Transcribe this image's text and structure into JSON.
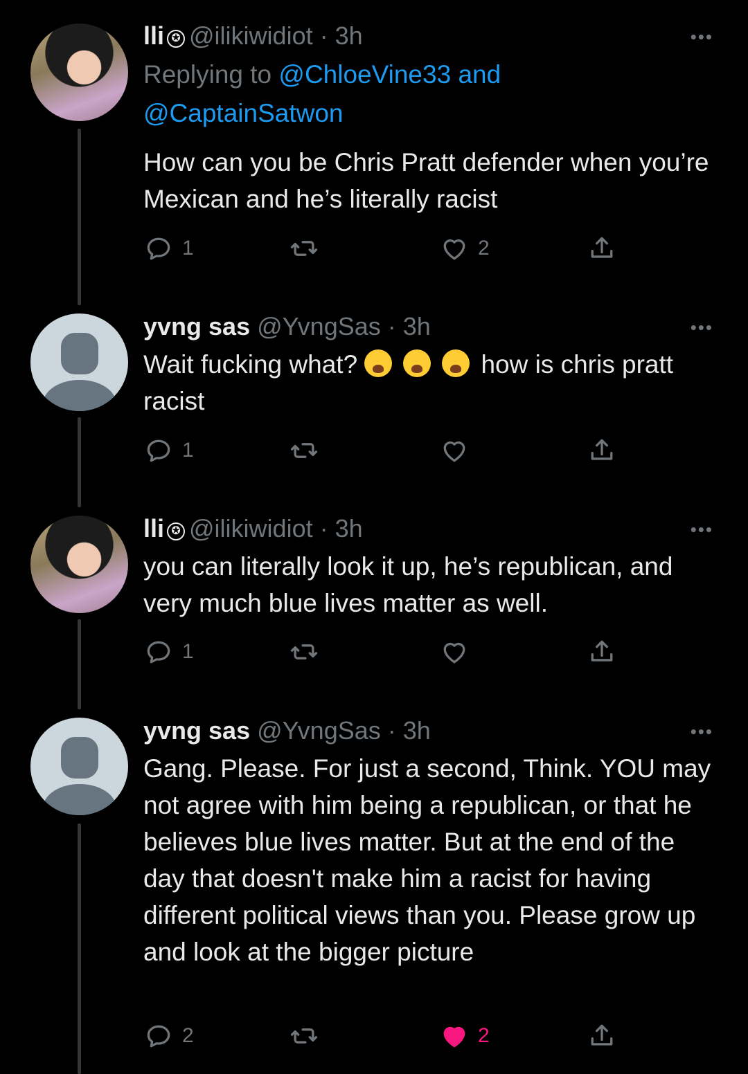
{
  "tweets": [
    {
      "avatar": "user-photo-avatar",
      "name": "lli",
      "handle": "@ilikiwidiot",
      "time": "· 3h",
      "replying_label": "Replying to ",
      "reply_to_1": "@ChloeVine33",
      "reply_and": " and",
      "reply_to_2": "@CaptainSatwon",
      "text": "How can you be Chris Pratt defender when you’re Mexican and he’s literally racist",
      "replies": "1",
      "retweets": "",
      "likes": "2",
      "liked": false
    },
    {
      "avatar": "default-avatar",
      "name": "yvng sas",
      "handle": "@YvngSas",
      "time": "· 3h",
      "text_before": "Wait fucking what?",
      "emojis": [
        "loudly-crying-face-emoji",
        "loudly-crying-face-emoji",
        "loudly-crying-face-emoji"
      ],
      "text_after": "how is chris pratt racist",
      "replies": "1",
      "retweets": "",
      "likes": "",
      "liked": false
    },
    {
      "avatar": "user-photo-avatar",
      "name": "lli",
      "handle": "@ilikiwidiot",
      "time": "· 3h",
      "text": "you can literally look it up, he’s republican, and very much blue lives matter as well.",
      "replies": "1",
      "retweets": "",
      "likes": "",
      "liked": false
    },
    {
      "avatar": "default-avatar",
      "name": "yvng sas",
      "handle": "@YvngSas",
      "time": "· 3h",
      "text": "Gang. Please. For just a second, Think. YOU may not agree with him being a republican, or that he believes blue lives matter. But at the end of the day that doesn't make him a racist for having different political views than you. Please grow up and look at the bigger picture",
      "replies": "2",
      "retweets": "",
      "likes": "2",
      "liked": true
    }
  ],
  "colors": {
    "background": "#000000",
    "text": "#e7e9ea",
    "muted": "#71767b",
    "link": "#1d9bf0",
    "like": "#f91880"
  },
  "icons": {
    "more": "more-icon",
    "reply": "reply-icon",
    "retweet": "retweet-icon",
    "like": "heart-icon",
    "share": "share-icon"
  },
  "more_glyph": "•••"
}
